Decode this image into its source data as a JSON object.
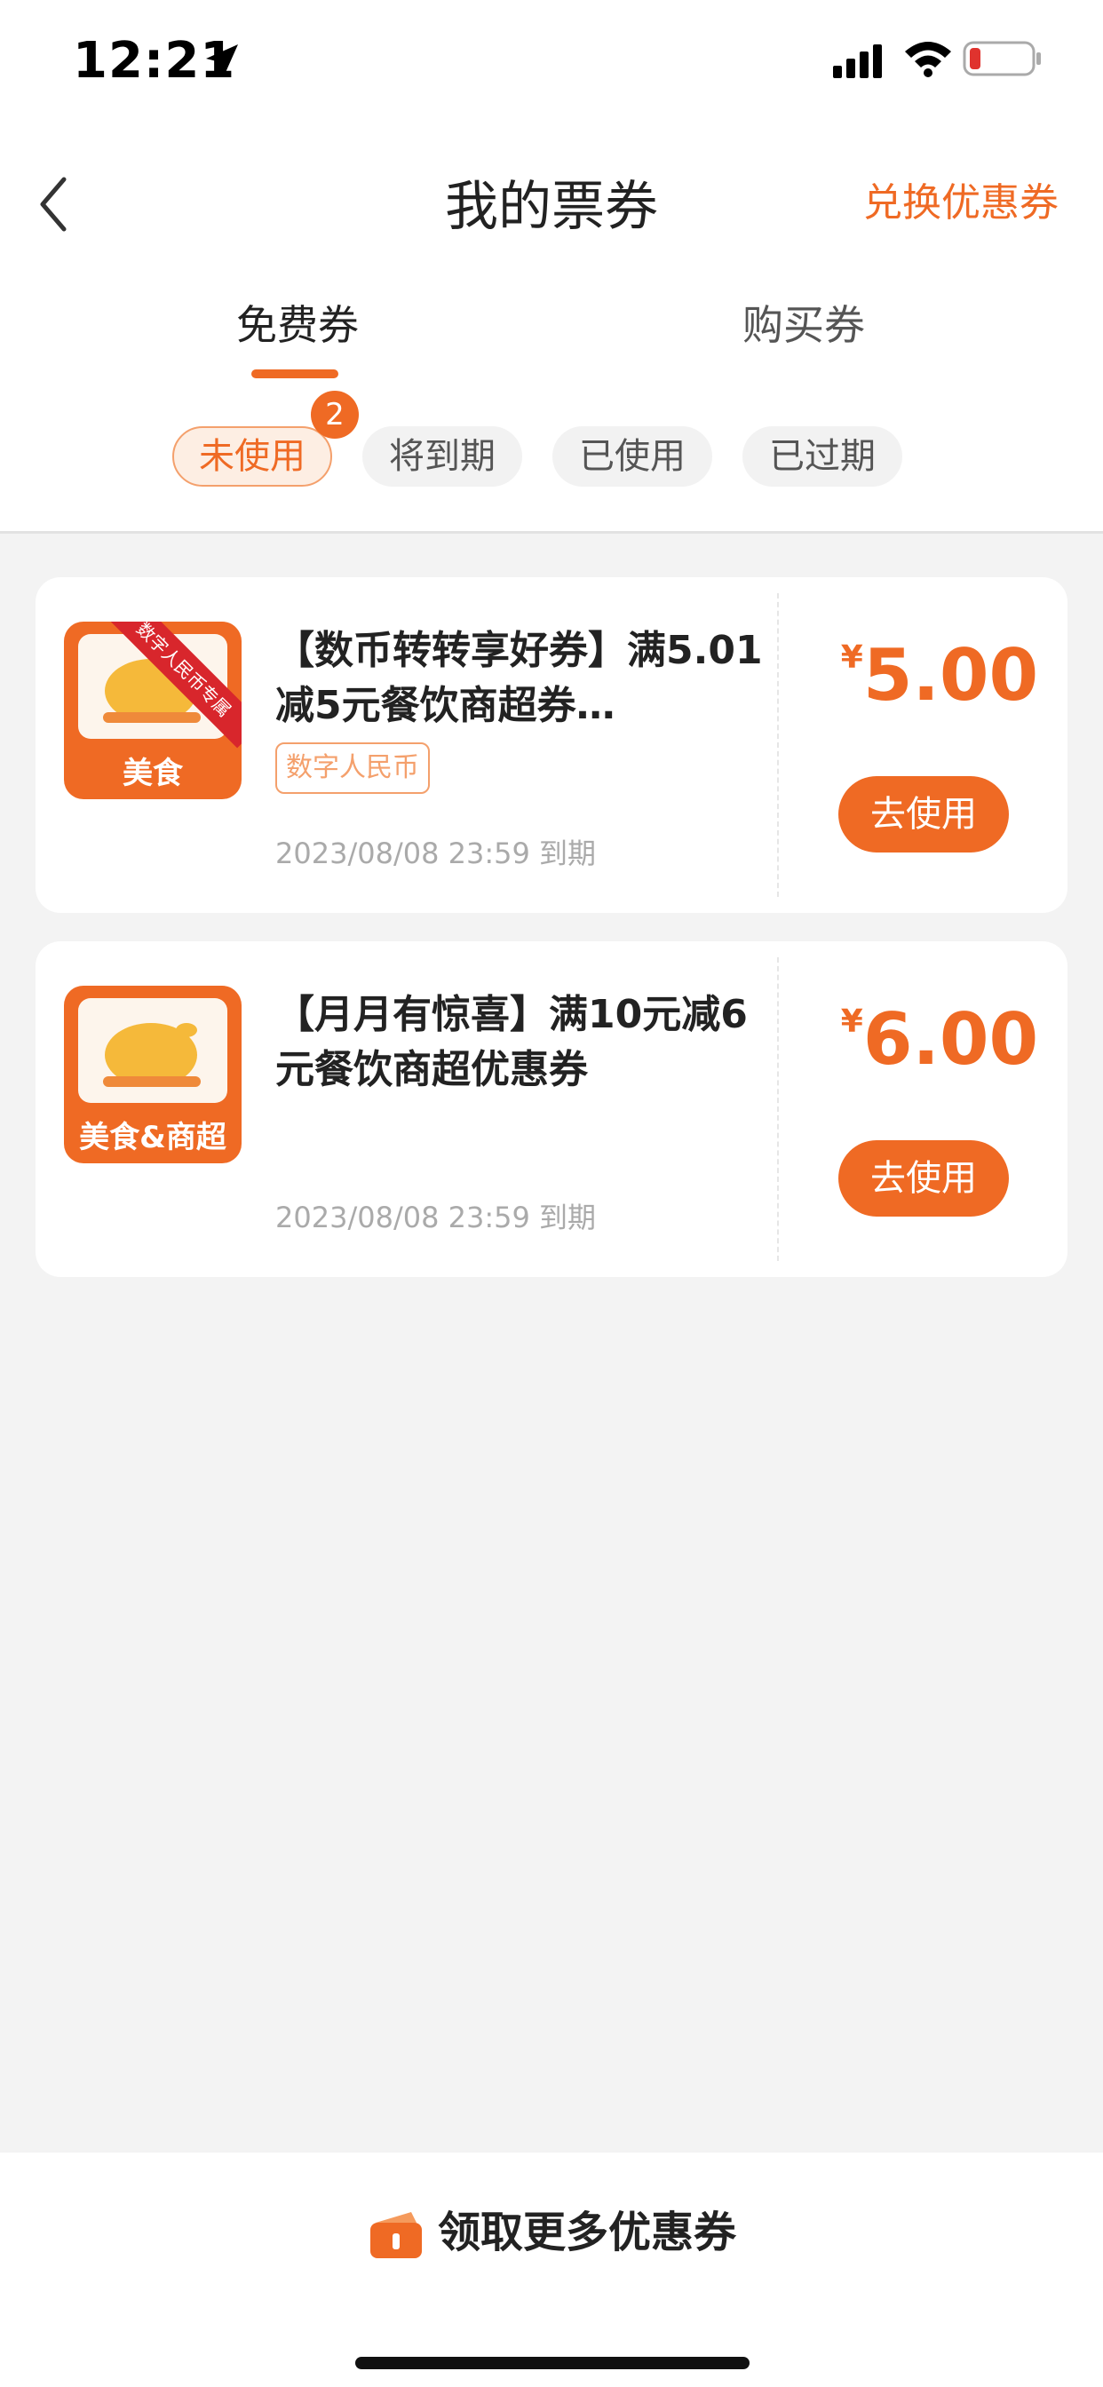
{
  "status_bar": {
    "time": "12:21"
  },
  "header": {
    "title": "我的票券",
    "redeem_label": "兑换优惠券"
  },
  "tabs": [
    {
      "label": "免费券",
      "active": true
    },
    {
      "label": "购买券",
      "active": false
    }
  ],
  "filters": {
    "chips": [
      {
        "label": "未使用"
      },
      {
        "label": "将到期"
      },
      {
        "label": "已使用"
      },
      {
        "label": "已过期"
      }
    ],
    "unused_count": "2"
  },
  "coupons": [
    {
      "thumb_label": "美食",
      "ribbon": "数字人民币专属",
      "title": "【数币转转享好券】满5.01减5元餐饮商超券…",
      "tag": "数字人民币",
      "expiry": "2023/08/08 23:59 到期",
      "currency": "¥",
      "amount": "5.00",
      "action": "去使用"
    },
    {
      "thumb_label": "美食&商超",
      "title": "【月月有惊喜】满10元减6元餐饮商超优惠券",
      "expiry": "2023/08/08 23:59 到期",
      "currency": "¥",
      "amount": "6.00",
      "action": "去使用"
    }
  ],
  "footer": {
    "more_label": "领取更多优惠券"
  },
  "colors": {
    "accent": "#ef6a24",
    "ribbon": "#d8262c",
    "background": "#f3f3f3"
  }
}
